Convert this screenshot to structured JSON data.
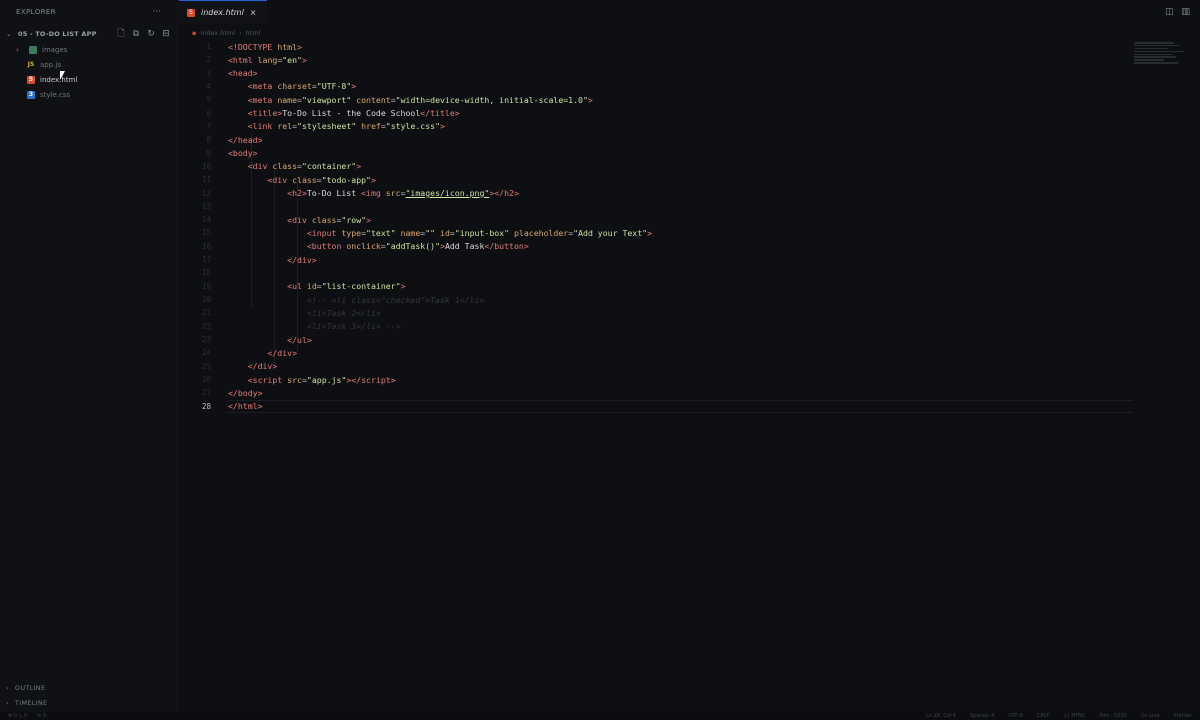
{
  "sidebar": {
    "title": "EXPLORER",
    "more": "···",
    "folder": "05 - TO-DO LIST APP",
    "items": [
      {
        "name": "images",
        "icon": "folder-icon",
        "type": "folder"
      },
      {
        "name": "app.js",
        "icon": "js-file-icon",
        "type": "js"
      },
      {
        "name": "index.html",
        "icon": "html-file-icon",
        "type": "html",
        "active": true
      },
      {
        "name": "style.css",
        "icon": "css-file-icon",
        "type": "css"
      }
    ],
    "outline": "OUTLINE",
    "timeline": "TIMELINE"
  },
  "tab": {
    "label": "index.html",
    "close": "×"
  },
  "breadcrumb": [
    "index.html",
    "html"
  ],
  "editor": {
    "current_line_number": "28",
    "lines": [
      {
        "n": "1",
        "html": "<span class='tag'>&lt;!DOCTYPE</span> <span class='attr'>html</span><span class='tag'>&gt;</span>"
      },
      {
        "n": "2",
        "html": "<span class='tag'>&lt;html</span> <span class='attr'>lang</span><span class='punc'>=</span><span class='str'>\"en\"</span><span class='tag'>&gt;</span>"
      },
      {
        "n": "3",
        "html": "<span class='tag'>&lt;head&gt;</span>"
      },
      {
        "n": "4",
        "html": "    <span class='tag'>&lt;meta</span> <span class='attr'>charset</span><span class='punc'>=</span><span class='str'>\"UTF-8\"</span><span class='tag'>&gt;</span>"
      },
      {
        "n": "5",
        "html": "    <span class='tag'>&lt;meta</span> <span class='attr'>name</span><span class='punc'>=</span><span class='str'>\"viewport\"</span> <span class='attr'>content</span><span class='punc'>=</span><span class='str'>\"width=device-width, initial-scale=1.0\"</span><span class='tag'>&gt;</span>"
      },
      {
        "n": "6",
        "html": "    <span class='tag'>&lt;title&gt;</span><span class='txt'>To-Do List - the Code School</span><span class='tag'>&lt;/title&gt;</span>"
      },
      {
        "n": "7",
        "html": "    <span class='tag'>&lt;link</span> <span class='attr'>rel</span><span class='punc'>=</span><span class='str'>\"stylesheet\"</span> <span class='attr'>href</span><span class='punc'>=</span><span class='str'>\"style.css\"</span><span class='tag'>&gt;</span>"
      },
      {
        "n": "8",
        "html": "<span class='tag'>&lt;/head&gt;</span>"
      },
      {
        "n": "9",
        "html": "<span class='tag'>&lt;body&gt;</span>"
      },
      {
        "n": "10",
        "html": "    <span class='tag'>&lt;div</span> <span class='attr'>class</span><span class='punc'>=</span><span class='str'>\"container\"</span><span class='tag'>&gt;</span>"
      },
      {
        "n": "11",
        "html": "        <span class='tag'>&lt;div</span> <span class='attr'>class</span><span class='punc'>=</span><span class='str'>\"todo-app\"</span><span class='tag'>&gt;</span>"
      },
      {
        "n": "12",
        "html": "            <span class='tag'>&lt;h2&gt;</span><span class='txt'>To-Do List </span><span class='tag'>&lt;img</span> <span class='attr'>src</span><span class='punc'>=</span><span class='link'>\"images/icon.png\"</span><span class='tag'>&gt;&lt;/h2&gt;</span>"
      },
      {
        "n": "13",
        "html": ""
      },
      {
        "n": "14",
        "html": "            <span class='tag'>&lt;div</span> <span class='attr'>class</span><span class='punc'>=</span><span class='str'>\"row\"</span><span class='tag'>&gt;</span>"
      },
      {
        "n": "15",
        "html": "                <span class='tag'>&lt;input</span> <span class='attr'>type</span><span class='punc'>=</span><span class='str'>\"text\"</span> <span class='attr'>name</span><span class='punc'>=</span><span class='str'>\"\"</span> <span class='attr'>id</span><span class='punc'>=</span><span class='str'>\"input-box\"</span> <span class='attr'>placeholder</span><span class='punc'>=</span><span class='str'>\"Add your Text\"</span><span class='tag'>&gt;</span>"
      },
      {
        "n": "16",
        "html": "                <span class='tag'>&lt;button</span> <span class='attr'>onclick</span><span class='punc'>=</span><span class='str'>\"addTask()\"</span><span class='tag'>&gt;</span><span class='txt'>Add Task</span><span class='tag'>&lt;/button&gt;</span>"
      },
      {
        "n": "17",
        "html": "            <span class='tag'>&lt;/div&gt;</span>"
      },
      {
        "n": "18",
        "html": ""
      },
      {
        "n": "19",
        "html": "            <span class='tag'>&lt;ul</span> <span class='attr'>id</span><span class='punc'>=</span><span class='str'>\"list-container\"</span><span class='tag'>&gt;</span>"
      },
      {
        "n": "20",
        "html": "                <span class='cmt'>&lt;!-- &lt;li class=\"checked\"&gt;Task 1&lt;/li&gt;</span>"
      },
      {
        "n": "21",
        "html": "                <span class='cmt'>&lt;li&gt;Task 2&lt;/li&gt;</span>"
      },
      {
        "n": "22",
        "html": "                <span class='cmt'>&lt;li&gt;Task 3&lt;/li&gt; --&gt;</span>"
      },
      {
        "n": "23",
        "html": "            <span class='tag'>&lt;/ul&gt;</span>"
      },
      {
        "n": "24",
        "html": "        <span class='tag'>&lt;/div&gt;</span>"
      },
      {
        "n": "25",
        "html": "    <span class='tag'>&lt;/div&gt;</span>"
      },
      {
        "n": "26",
        "html": "    <span class='tag'>&lt;script</span> <span class='attr'>src</span><span class='punc'>=</span><span class='str'>\"app.js\"</span><span class='tag'>&gt;&lt;/script&gt;</span>"
      },
      {
        "n": "27",
        "html": "<span class='tag'>&lt;/body&gt;</span>"
      },
      {
        "n": "28",
        "html": "<span class='tag'>&lt;/html&gt;</span>"
      }
    ]
  },
  "status": {
    "left": [
      "⊗ 0 △ 0",
      "⊘ 0"
    ],
    "right": [
      "Ln 28, Col 8",
      "Spaces: 4",
      "UTF-8",
      "CRLF",
      "{} HTML",
      "Port : 5500",
      "Go Live",
      "Prettier"
    ]
  }
}
